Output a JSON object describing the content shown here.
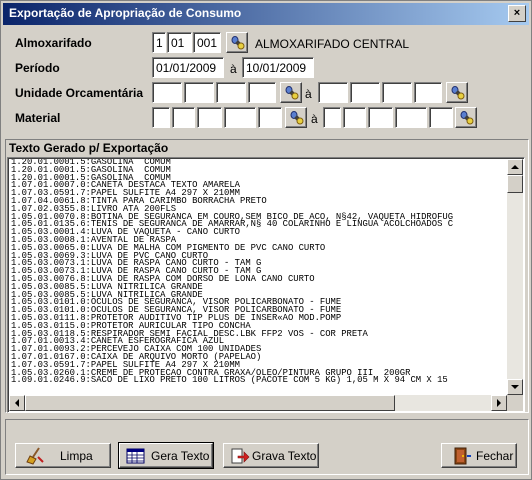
{
  "window": {
    "title": "Exportação de Apropriação de Consumo",
    "close_glyph": "×"
  },
  "form": {
    "almoxarifado": {
      "label": "Almoxarifado",
      "code1": "1",
      "code2": "01",
      "code3": "001",
      "name": "ALMOXARIFADO CENTRAL"
    },
    "periodo": {
      "label": "Período",
      "start": "01/01/2009",
      "separator": "à",
      "end": "10/01/2009"
    },
    "unidade": {
      "label": "Unidade Orcamentária",
      "separator": "à"
    },
    "material": {
      "label": "Material",
      "separator": "à"
    }
  },
  "output": {
    "label": "Texto Gerado p/ Exportação",
    "lines": [
      "1.20.01.0001.5:GASOLINA  COMUM",
      "1.20.01.0001.5:GASOLINA  COMUM",
      "1.20.01.0001.5:GASOLINA  COMUM",
      "1.07.01.0007.0:CANETA DESTACA TEXTO AMARELA",
      "1.07.03.0591.7:PAPEL SULFITE A4 297 X 210MM",
      "1.07.04.0061.8:TINTA PARA CARIMBO BORRACHA PRETO",
      "1.07.02.0355.8:LIVRO ATA 200FLS",
      "1.05.01.0070.8:BOTINA DE SEGURANCA EM COURO,SEM BICO DE ACO, N§42, VAQUETA HIDROFUG",
      "1.05.01.0135.6:TENIS DE SEGURANCA DE AMARRAR,N§ 40 COLARINHO E LINGUA ACOLCHOADOS C",
      "1.05.03.0001.4:LUVA DE VAQUETA - CANO CURTO",
      "1.05.03.0008.1:AVENTAL DE RASPA",
      "1.05.03.0065.0:LUVA DE MALHA COM PIGMENTO DE PVC CANO CURTO",
      "1.05.03.0069.3:LUVA DE PVC CANO CURTO",
      "1.05.03.0073.1:LUVA DE RASPA CANO CURTO - TAM G",
      "1.05.03.0073.1:LUVA DE RASPA CANO CURTO - TAM G",
      "1.05.03.0076.8:LUVA DE RASPA COM DORSO DE LONA CANO CURTO",
      "1.05.03.0085.5:LUVA NITRILICA GRANDE",
      "1.05.03.0085.5:LUVA NITRILICA GRANDE",
      "1.05.03.0101.0:OCULOS DE SEGURANCA, VISOR POLICARBONATO - FUME",
      "1.05.03.0101.0:OCULOS DE SEGURANCA, VISOR POLICARBONATO - FUME",
      "1.05.03.0111.8:PROTETOR AUDITIVO TIP PLUS DE INSER«AO MOD.POMP",
      "1.05.03.0115.0:PROTETOR AURICULAR TIPO CONCHA",
      "1.05.03.0118.5:RESPIRADOR SEMI FACIAL DESC.LBK FFP2 VOS - COR PRETA",
      "1.07.01.0013.4:CANETA ESFEROGRAFICA AZUL",
      "1.07.01.0093.2:PERCEVEJO CAIXA COM 100 UNIDADES",
      "1.07.01.0167.0:CAIXA DE ARQUIVO MORTO (PAPELAO)",
      "1.07.03.0591.7:PAPEL SULFITE A4 297 X 210MM",
      "1.05.03.0260.1:CREME DE PROTECAO CONTRA GRAXA/OLEO/PINTURA GRUPO III  200GR",
      "1.09.01.0246.9:SACO DE LIXO PRETO 100 LITROS (PACOTE COM 5 KG) 1,05 M X 94 CM X 15"
    ]
  },
  "buttons": {
    "limpa": "Limpa",
    "gera_texto": "Gera Texto",
    "grava_texto": "Grava Texto",
    "fechar": "Fechar"
  }
}
